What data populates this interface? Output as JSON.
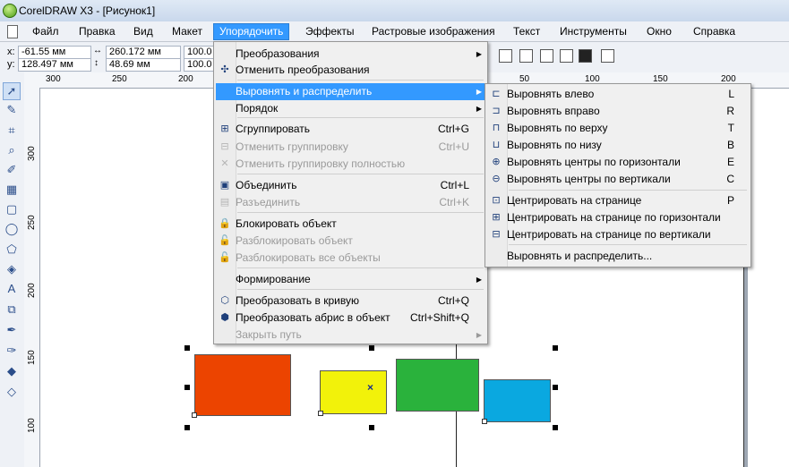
{
  "window": {
    "title": "CorelDRAW X3 - [Рисунок1]"
  },
  "menubar": {
    "items": [
      {
        "label": "Файл"
      },
      {
        "label": "Правка"
      },
      {
        "label": "Вид"
      },
      {
        "label": "Макет"
      },
      {
        "label": "Упорядочить"
      },
      {
        "label": "Эффекты"
      },
      {
        "label": "Растровые изображения"
      },
      {
        "label": "Текст"
      },
      {
        "label": "Инструменты"
      },
      {
        "label": "Окно"
      },
      {
        "label": "Справка"
      }
    ],
    "active_index": 4
  },
  "propbar": {
    "x_label": "x:",
    "x_value": "-61.55 мм",
    "y_label": "y:",
    "y_value": "128.497 мм",
    "w_value": "260.172 мм",
    "h_value": "48.69 мм",
    "scale_x": "100.0",
    "scale_y": "100.0"
  },
  "ruler": {
    "top_ticks": [
      "300",
      "250",
      "200",
      "50",
      "100",
      "150",
      "200"
    ],
    "left_ticks": [
      "300",
      "250",
      "200",
      "150",
      "100"
    ]
  },
  "tools": [
    "pick-tool",
    "shape-tool",
    "crop-tool",
    "zoom-tool",
    "freehand-tool",
    "smart-fill-tool",
    "rectangle-tool",
    "ellipse-tool",
    "polygon-tool",
    "basic-shapes-tool",
    "text-tool",
    "interactive-blend-tool",
    "eyedropper-tool",
    "outline-tool",
    "fill-tool",
    "interactive-fill-tool"
  ],
  "main_menu": {
    "items": [
      {
        "label": "Преобразования",
        "shortcut": "",
        "submenu": true,
        "disabled": false,
        "icon": ""
      },
      {
        "label": "Отменить преобразования",
        "shortcut": "",
        "submenu": false,
        "disabled": false,
        "icon": "clear-transform-icon"
      },
      {
        "label": "Выровнять и распределить",
        "shortcut": "",
        "submenu": true,
        "disabled": false,
        "icon": "",
        "highlighted": true
      },
      {
        "label": "Порядок",
        "shortcut": "",
        "submenu": true,
        "disabled": false,
        "icon": ""
      },
      {
        "label": "Сгруппировать",
        "shortcut": "Ctrl+G",
        "submenu": false,
        "disabled": false,
        "icon": "group-icon"
      },
      {
        "label": "Отменить группировку",
        "shortcut": "Ctrl+U",
        "submenu": false,
        "disabled": true,
        "icon": "ungroup-icon"
      },
      {
        "label": "Отменить группировку полностью",
        "shortcut": "",
        "submenu": false,
        "disabled": true,
        "icon": "ungroup-all-icon"
      },
      {
        "label": "Объединить",
        "shortcut": "Ctrl+L",
        "submenu": false,
        "disabled": false,
        "icon": "combine-icon"
      },
      {
        "label": "Разъединить",
        "shortcut": "Ctrl+K",
        "submenu": false,
        "disabled": true,
        "icon": "break-apart-icon"
      },
      {
        "label": "Блокировать объект",
        "shortcut": "",
        "submenu": false,
        "disabled": false,
        "icon": "lock-icon"
      },
      {
        "label": "Разблокировать объект",
        "shortcut": "",
        "submenu": false,
        "disabled": true,
        "icon": "unlock-icon"
      },
      {
        "label": "Разблокировать все объекты",
        "shortcut": "",
        "submenu": false,
        "disabled": true,
        "icon": "unlock-all-icon"
      },
      {
        "label": "Формирование",
        "shortcut": "",
        "submenu": true,
        "disabled": false,
        "icon": ""
      },
      {
        "label": "Преобразовать в кривую",
        "shortcut": "Ctrl+Q",
        "submenu": false,
        "disabled": false,
        "icon": "convert-to-curves-icon"
      },
      {
        "label": "Преобразовать абрис в объект",
        "shortcut": "Ctrl+Shift+Q",
        "submenu": false,
        "disabled": false,
        "icon": "outline-to-object-icon"
      },
      {
        "label": "Закрыть путь",
        "shortcut": "",
        "submenu": true,
        "disabled": true,
        "icon": ""
      }
    ]
  },
  "align_menu": {
    "items": [
      {
        "label": "Выровнять влево",
        "shortcut": "L",
        "icon": "align-left-icon"
      },
      {
        "label": "Выровнять вправо",
        "shortcut": "R",
        "icon": "align-right-icon"
      },
      {
        "label": "Выровнять по верху",
        "shortcut": "T",
        "icon": "align-top-icon"
      },
      {
        "label": "Выровнять по низу",
        "shortcut": "B",
        "icon": "align-bottom-icon"
      },
      {
        "label": "Выровнять центры по горизонтали",
        "shortcut": "E",
        "icon": "align-h-centers-icon"
      },
      {
        "label": "Выровнять центры по вертикали",
        "shortcut": "C",
        "icon": "align-v-centers-icon"
      },
      {
        "label": "Центрировать на странице",
        "shortcut": "P",
        "icon": "center-on-page-icon"
      },
      {
        "label": "Центрировать на странице по горизонтали",
        "shortcut": "",
        "icon": "center-page-h-icon"
      },
      {
        "label": "Центрировать на странице по вертикали",
        "shortcut": "",
        "icon": "center-page-v-icon"
      },
      {
        "label": "Выровнять и распределить...",
        "shortcut": "",
        "icon": ""
      }
    ]
  },
  "colors": {
    "accent": "#3399ff",
    "shape_red": "#ec4400",
    "shape_yellow": "#f2f20a",
    "shape_green": "#2ab23c",
    "shape_blue": "#0aa8e0"
  }
}
